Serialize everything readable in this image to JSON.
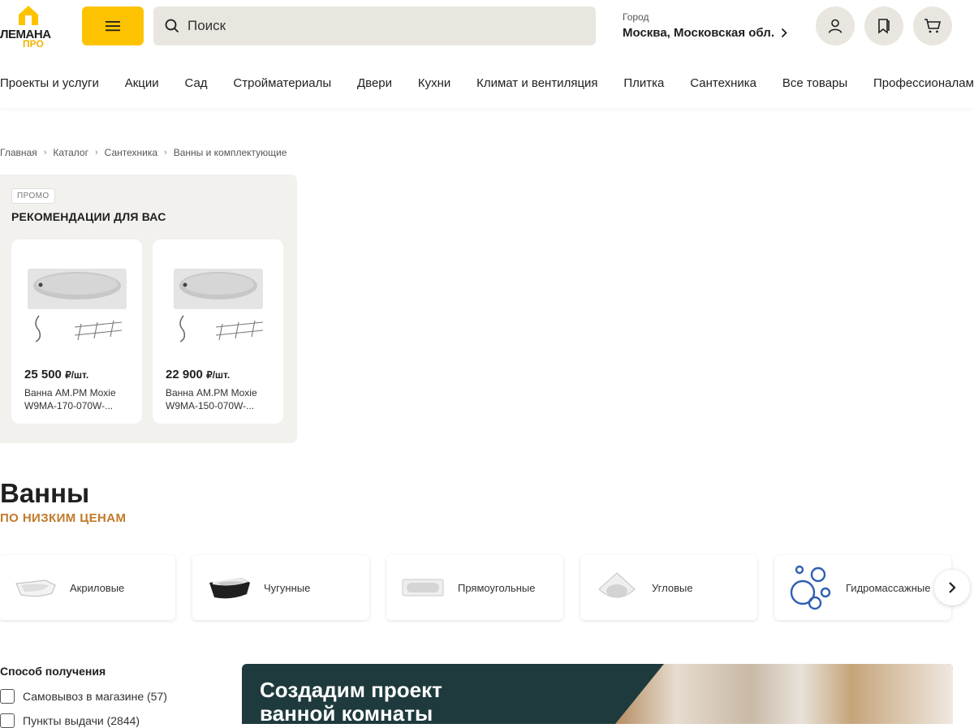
{
  "header": {
    "logo_top": "ЛЕМАНА",
    "logo_bottom": "ПРО",
    "search_placeholder": "Поиск",
    "city_label": "Город",
    "city_value": "Москва, Московская обл."
  },
  "nav": [
    "Проекты и услуги",
    "Акции",
    "Сад",
    "Стройматериалы",
    "Двери",
    "Кухни",
    "Климат и вентиляция",
    "Плитка",
    "Сантехника",
    "Все товары",
    "Профессионалам"
  ],
  "breadcrumb": [
    "Главная",
    "Каталог",
    "Сантехника",
    "Ванны и комплектующие"
  ],
  "promo": {
    "badge": "ПРОМО",
    "title": "РЕКОМЕНДАЦИИ ДЛЯ ВАС",
    "products": [
      {
        "price": "25 500",
        "unit": "₽/шт.",
        "name_line1": "Ванна AM.PM Moxie",
        "name_line2": "W9MA-170-070W-..."
      },
      {
        "price": "22 900",
        "unit": "₽/шт.",
        "name_line1": "Ванна AM.PM Moxie",
        "name_line2": "W9MA-150-070W-..."
      }
    ]
  },
  "page": {
    "title": "Ванны",
    "subtitle": "ПО НИЗКИМ ЦЕНАМ"
  },
  "categories": [
    "Акриловые",
    "Чугунные",
    "Прямоугольные",
    "Угловые",
    "Гидромассажные"
  ],
  "filters": {
    "title": "Способ получения",
    "options": [
      {
        "label": "Самовывоз в магазине (57)"
      },
      {
        "label": "Пункты выдачи (2844)"
      }
    ]
  },
  "banner": {
    "line1": "Создадим проект",
    "line2": "ванной комнаты"
  },
  "colors": {
    "accent": "#fdc300",
    "subtitle": "#c27a2a",
    "banner": "#1e3a3c"
  }
}
